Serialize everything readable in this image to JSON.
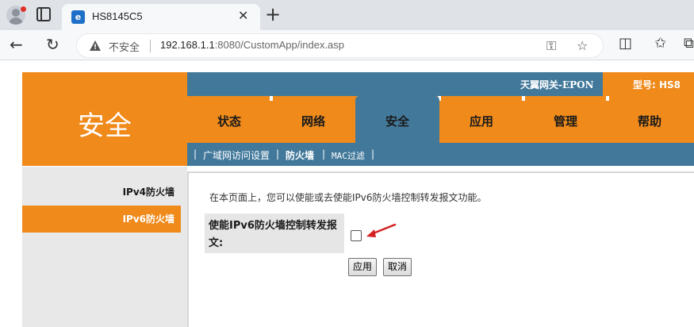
{
  "browser": {
    "tab_title": "HS8145C5",
    "favicon_text": "e",
    "security_label": "不安全",
    "url_host": "192.168.1.1",
    "url_rest": ":8080/CustomApp/index.asp"
  },
  "header": {
    "brand": "天翼网关-EPON",
    "model": "型号: HS8"
  },
  "page_title": "安全",
  "menu": {
    "items": [
      {
        "label": "状态"
      },
      {
        "label": "网络"
      },
      {
        "label": "安全"
      },
      {
        "label": "应用"
      },
      {
        "label": "管理"
      },
      {
        "label": "帮助"
      }
    ],
    "active_index": 2
  },
  "submenu": {
    "sep": "|",
    "wan_access": "广域网访问设置",
    "firewall": "防火墙",
    "mac_filter": "MAC过滤"
  },
  "sidebar": {
    "items": [
      {
        "label": "IPv4防火墙"
      },
      {
        "label": "IPv6防火墙"
      }
    ],
    "active_index": 1
  },
  "main": {
    "intro": "在本页面上，您可以使能或去使能IPv6防火墙控制转发报文功能。",
    "field_label_line1": "使能IPv6防火墙控制转发报",
    "field_label_line2": "文:",
    "checkbox_checked": false,
    "apply_label": "应用",
    "cancel_label": "取消"
  },
  "colors": {
    "orange": "#ef8a1b",
    "steel_blue": "#42799b",
    "arrow_red": "#d42020"
  }
}
